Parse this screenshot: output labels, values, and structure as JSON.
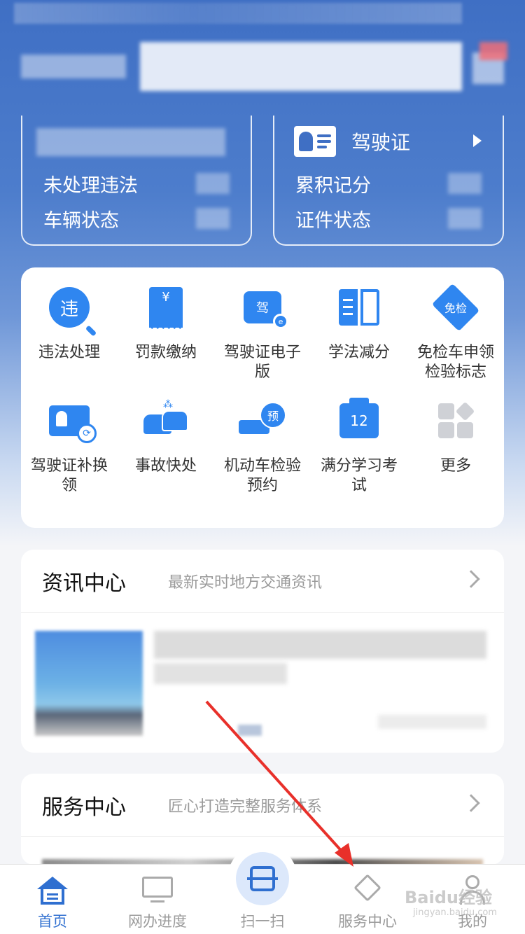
{
  "cards": {
    "left": {
      "row1": "未处理违法",
      "row2": "车辆状态"
    },
    "right": {
      "title": "驾驶证",
      "row1": "累积记分",
      "row2": "证件状态"
    }
  },
  "services": [
    {
      "label": "违法处理",
      "icon": "violation-search-icon",
      "glyph": "违"
    },
    {
      "label": "罚款缴纳",
      "icon": "fine-receipt-icon",
      "glyph": "¥"
    },
    {
      "label": "驾驶证电子版",
      "icon": "e-license-wallet-icon",
      "glyph": "驾"
    },
    {
      "label": "学法减分",
      "icon": "book-icon"
    },
    {
      "label": "免检车申领检验标志",
      "icon": "inspection-free-icon",
      "glyph": "免检"
    },
    {
      "label": "驾驶证补换领",
      "icon": "license-renew-icon"
    },
    {
      "label": "事故快处",
      "icon": "accident-cars-icon"
    },
    {
      "label": "机动车检验预约",
      "icon": "inspection-booking-icon",
      "glyph": "预"
    },
    {
      "label": "满分学习考试",
      "icon": "calendar-exam-icon",
      "glyph": "12"
    },
    {
      "label": "更多",
      "icon": "more-grid-icon"
    }
  ],
  "news": {
    "title": "资讯中心",
    "subtitle": "最新实时地方交通资讯"
  },
  "service_center": {
    "title": "服务中心",
    "subtitle": "匠心打造完整服务体系"
  },
  "tabbar": {
    "home": "首页",
    "progress": "网办进度",
    "scan": "扫一扫",
    "service": "服务中心",
    "mine": "我的"
  },
  "watermark": {
    "main": "Baidu经验",
    "sub": "jingyan.baidu.com"
  },
  "colors": {
    "accent": "#2f86f0",
    "brand": "#2f6fd0",
    "annotation_arrow": "#e8302a"
  }
}
